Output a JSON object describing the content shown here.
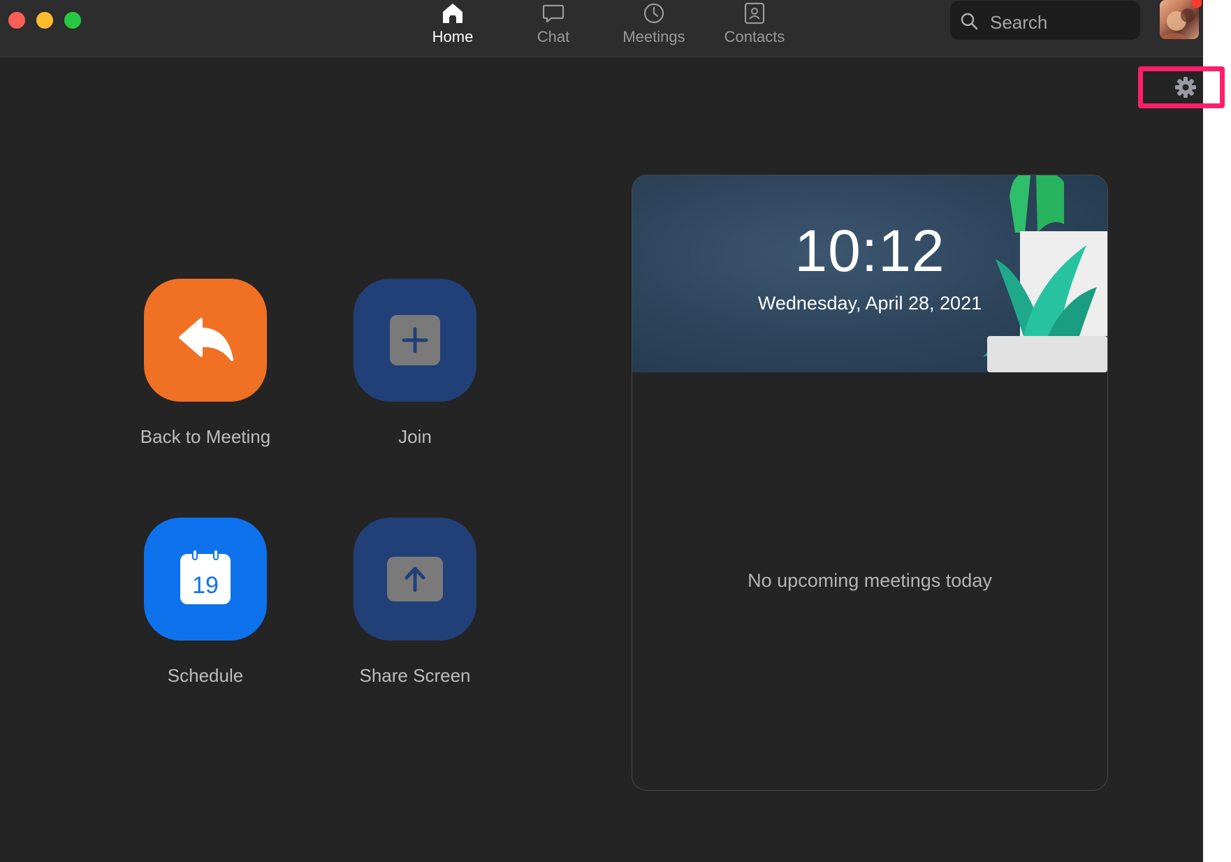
{
  "nav": {
    "tabs": [
      {
        "label": "Home",
        "icon": "home-icon",
        "active": true
      },
      {
        "label": "Chat",
        "icon": "chat-icon",
        "active": false
      },
      {
        "label": "Meetings",
        "icon": "clock-icon",
        "active": false
      },
      {
        "label": "Contacts",
        "icon": "contact-card-icon",
        "active": false
      }
    ]
  },
  "search": {
    "placeholder": "Search",
    "icon": "search-icon"
  },
  "profile": {
    "icon": "avatar",
    "has_notification": true,
    "notification_color": "#ff3b30"
  },
  "settings": {
    "icon": "gear-icon",
    "highlighted": true,
    "highlight_color": "#ff1f6a"
  },
  "actions": [
    {
      "label": "Back to Meeting",
      "icon": "reply-arrow-icon",
      "color": "#f07124"
    },
    {
      "label": "Join",
      "icon": "plus-icon",
      "color": "#214078"
    },
    {
      "label": "Schedule",
      "icon": "calendar-icon",
      "calendar_day": "19",
      "color": "#0e72ed"
    },
    {
      "label": "Share Screen",
      "icon": "upload-arrow-icon",
      "color": "#214078"
    }
  ],
  "calendar": {
    "time": "10:12",
    "date": "Wednesday, April 28, 2021",
    "empty_message": "No upcoming meetings today"
  }
}
